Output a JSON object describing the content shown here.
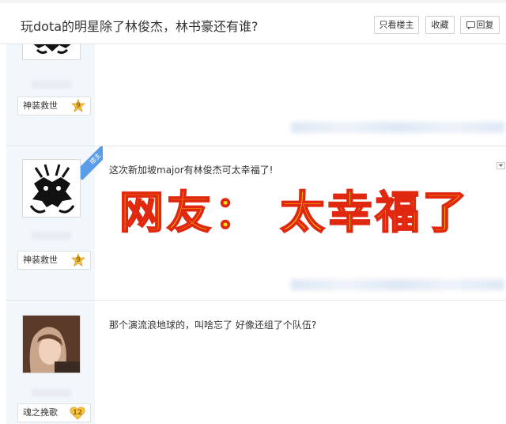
{
  "thread": {
    "title": "玩dota的明星除了林俊杰，林书豪还有谁?"
  },
  "toolbar": {
    "only_op_label": "只看楼主",
    "favorite_label": "收藏",
    "reply_label": "回复"
  },
  "posts": [
    {
      "username": "神装救世",
      "level": "9",
      "text": ""
    },
    {
      "username": "神装救世",
      "level": "9",
      "op_badge": "楼主",
      "text": "这次新加坡major有林俊杰可太幸福了!"
    },
    {
      "username": "魂之挽歌",
      "level": "12",
      "text": "那个演流浪地球的，叫啥忘了 好像还组了个队伍?"
    }
  ],
  "overlay": {
    "caption": "网友：  太幸福了"
  },
  "colors": {
    "sidebar_bg": "#f2f7fc",
    "op_ribbon": "#5a9ce8",
    "level_badge": "#f6c645",
    "overlay_fill": "#f7ea00",
    "overlay_stroke": "#e02810"
  }
}
